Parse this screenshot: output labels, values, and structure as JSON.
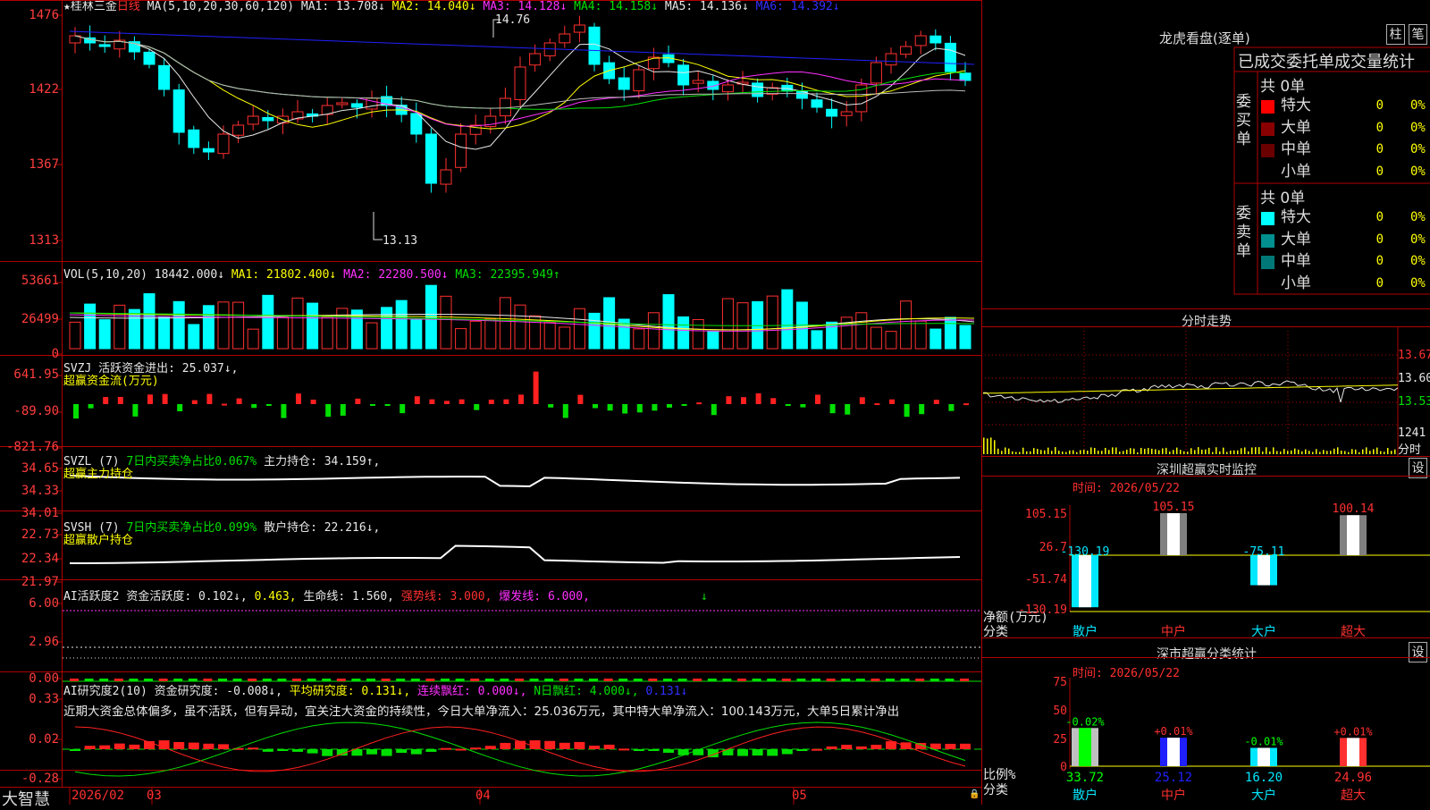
{
  "stock": {
    "title": "★桂林三金",
    "period": "日线"
  },
  "main": {
    "ma_header": {
      "label": "MA(5,10,20,30,60,120)",
      "ma1": "MA1: 13.708↓",
      "ma2": "MA2: 14.040↓",
      "ma3": "MA3: 14.128↓",
      "ma4": "MA4: 14.158↓",
      "ma5": "MA5: 14.136↓",
      "ma6": "MA6: 14.392↓"
    },
    "y_ticks": [
      "1476",
      "1422",
      "1367",
      "1313"
    ],
    "high_label": "14.76",
    "low_label": "13.13"
  },
  "vol": {
    "header": {
      "label": "VOL(5,10,20)",
      "val": "18442.000↓",
      "ma1": "MA1: 21802.400↓",
      "ma2": "MA2: 22280.500↓",
      "ma3": "MA3: 22395.949↑"
    },
    "y_ticks": [
      "53661",
      "26499",
      "0"
    ]
  },
  "svzj": {
    "header": {
      "label": "SVZJ",
      "t1": "活跃资金进出: 25.037↓,",
      "t2": "超赢资金流(万元)"
    },
    "y_ticks": [
      "641.95",
      "-89.90",
      "-821.76"
    ]
  },
  "svzl": {
    "header": {
      "label": "SVZL (7)",
      "t1": "7日内买卖净占比0.067%",
      "t2": "主力持仓: 34.159↑,",
      "t3": "超赢主力持仓"
    },
    "y_ticks": [
      "34.65",
      "34.33",
      "34.01"
    ]
  },
  "svsh": {
    "header": {
      "label": "SVSH (7)",
      "t1": "7日内买卖净占比0.099%",
      "t2": "散户持仓: 22.216↓,",
      "t3": "超赢散户持仓"
    },
    "y_ticks": [
      "22.73",
      "22.34",
      "21.97"
    ]
  },
  "ai1": {
    "header": {
      "label": "AI活跃度2",
      "t1": "资金活跃度: 0.102↓,",
      "t2": "0.463,",
      "t3": "生命线: 1.560,",
      "t4": "强势线: 3.000,",
      "t5": "爆发线: 6.000,",
      "t6": "↓"
    },
    "y_ticks": [
      "6.00",
      "2.96",
      "0.00"
    ]
  },
  "ai2": {
    "header": {
      "label": "AI研究度2(10)",
      "t1": "资金研究度: -0.008↓,",
      "t2": "平均研究度: 0.131↓,",
      "t3": "连续飘红: 0.000↓,",
      "t4": "N日飘红: 4.000↓,",
      "t5": "0.131↓"
    },
    "comment": "近期大资金总体偏多，虽不活跃，但有异动，宜关注大资金的持续性，今日大单净流入：25.036万元，其中特大单净流入：100.143万元，大单5日累计净出",
    "y_ticks": [
      "0.33",
      "0.02",
      "-0.28"
    ]
  },
  "bottom": {
    "brand": "大智慧",
    "dates": [
      "2026/02",
      "03",
      "04",
      "05"
    ]
  },
  "right": {
    "dragon_title": "龙虎看盘(逐单)",
    "btn_bar": "柱",
    "btn_note": "笔",
    "ob_title": "已成交委托单成交量统计",
    "buy_side": "委买单",
    "sell_side": "委卖单",
    "buy_total": "共 0单",
    "sell_total": "共 0单",
    "buy_rows": [
      {
        "label": "特大",
        "val": "0",
        "pct": "0%",
        "color": "#ff0000"
      },
      {
        "label": "大单",
        "val": "0",
        "pct": "0%",
        "color": "#8a0000"
      },
      {
        "label": "中单",
        "val": "0",
        "pct": "0%",
        "color": "#6a0000"
      },
      {
        "label": "小单",
        "val": "0",
        "pct": "0%",
        "color": "#000000"
      }
    ],
    "sell_rows": [
      {
        "label": "特大",
        "val": "0",
        "pct": "0%",
        "color": "#00ffff"
      },
      {
        "label": "大单",
        "val": "0",
        "pct": "0%",
        "color": "#009090"
      },
      {
        "label": "中单",
        "val": "0",
        "pct": "0%",
        "color": "#007878"
      },
      {
        "label": "小单",
        "val": "0",
        "pct": "0%",
        "color": "#000000"
      }
    ],
    "intraday_title": "分时走势",
    "intraday_ticks": [
      "13.67",
      "13.60",
      "13.53"
    ],
    "intraday_vol": "1241",
    "intraday_vol_unit": "分时",
    "monitor_title": "深圳超赢实时监控",
    "monitor_time": "时间: 2026/05/22",
    "btn_set": "设",
    "monitor_ticks": [
      "105.15",
      "26.7",
      "-51.74",
      "-130.19"
    ],
    "monitor_unit": "净额(万元)",
    "monitor_cat_label": "分类",
    "stats_title": "深市超赢分类统计",
    "stats_time": "时间: 2026/05/22",
    "stats_ticks": [
      "75",
      "50",
      "25",
      "0"
    ],
    "stats_unit": "比例%",
    "stats_cat_label": "分类"
  },
  "chart_data": [
    {
      "type": "bar",
      "title": "深圳超赢实时监控",
      "categories": [
        "散户",
        "中户",
        "大户",
        "超大"
      ],
      "values": [
        -130.19,
        105.15,
        -75.11,
        100.14
      ],
      "ylabel": "净额(万元)",
      "ylim": [
        -130.19,
        105.15
      ]
    },
    {
      "type": "bar",
      "title": "深市超赢分类统计",
      "categories": [
        "散户",
        "中户",
        "大户",
        "超大"
      ],
      "values": [
        33.72,
        25.12,
        16.2,
        24.96
      ],
      "changes": [
        "-0.02%",
        "+0.01%",
        "-0.01%",
        "+0.01%"
      ],
      "ylabel": "比例%",
      "ylim": [
        0,
        75
      ]
    }
  ]
}
